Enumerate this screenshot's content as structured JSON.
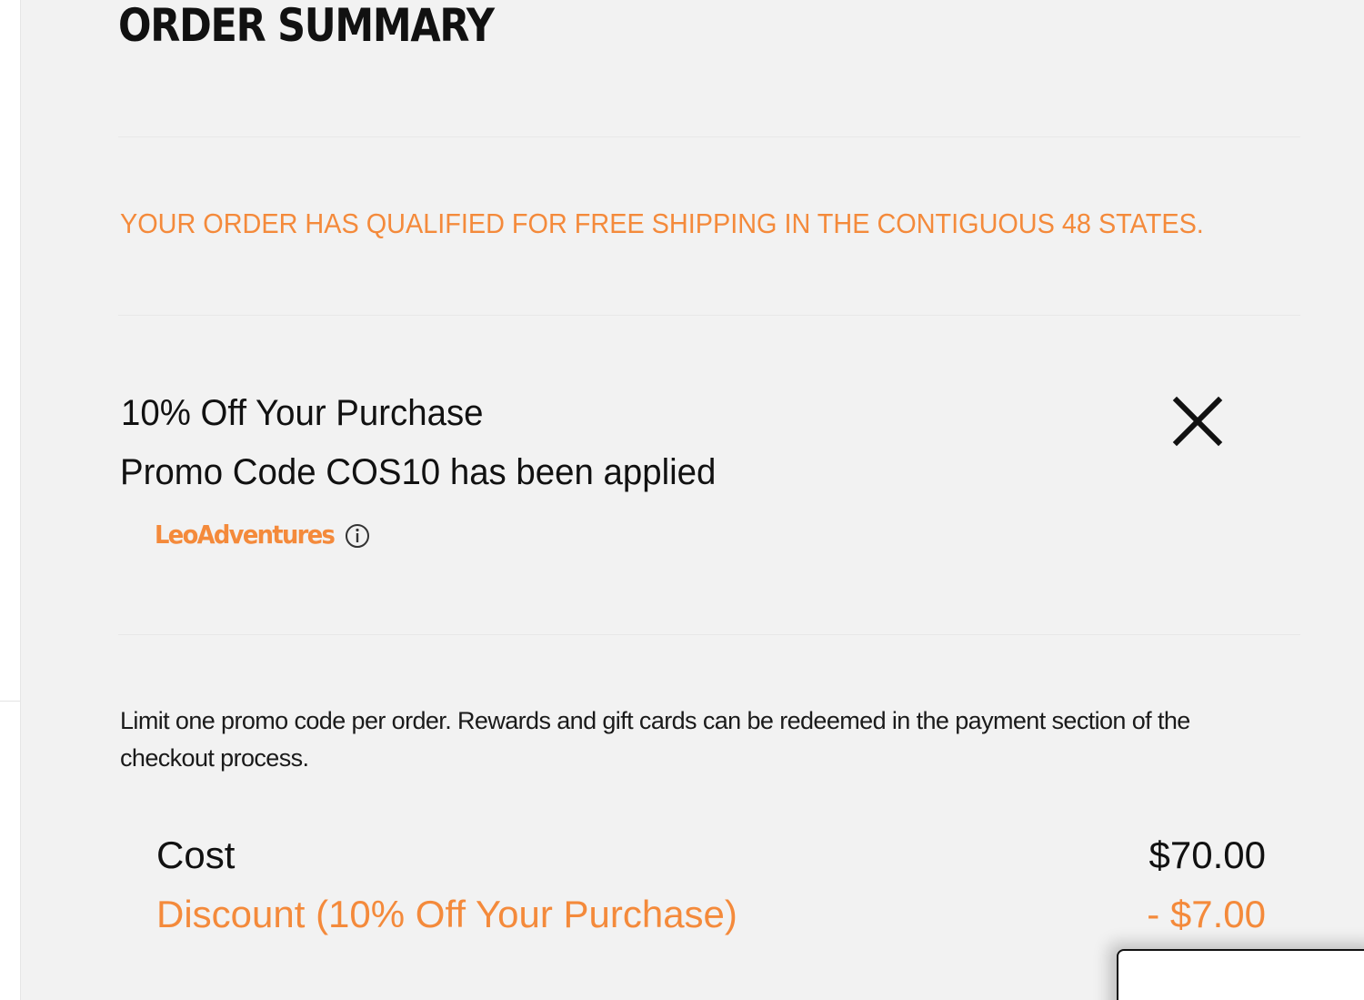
{
  "order_summary": {
    "title": "ORDER SUMMARY",
    "shipping_message": "YOUR ORDER HAS QUALIFIED FOR FREE SHIPPING IN THE CONTIGUOUS 48 STATES.",
    "promo": {
      "title": "10% Off Your Purchase",
      "applied_message": "Promo Code COS10 has been applied",
      "remove_icon": "close-icon",
      "brand_name": "LeoAdventures",
      "info_icon": "info-icon"
    },
    "fine_print": "Limit one promo code per order. Rewards and gift cards can be redeemed in the payment section of the checkout process.",
    "totals": {
      "cost_label": "Cost",
      "cost_value": "$70.00",
      "discount_label": "Discount (10% Off Your Purchase)",
      "discount_value": "- $7.00"
    }
  },
  "colors": {
    "accent": "#f48a3b",
    "panel_background": "#f2f2f2",
    "text": "#111111"
  }
}
